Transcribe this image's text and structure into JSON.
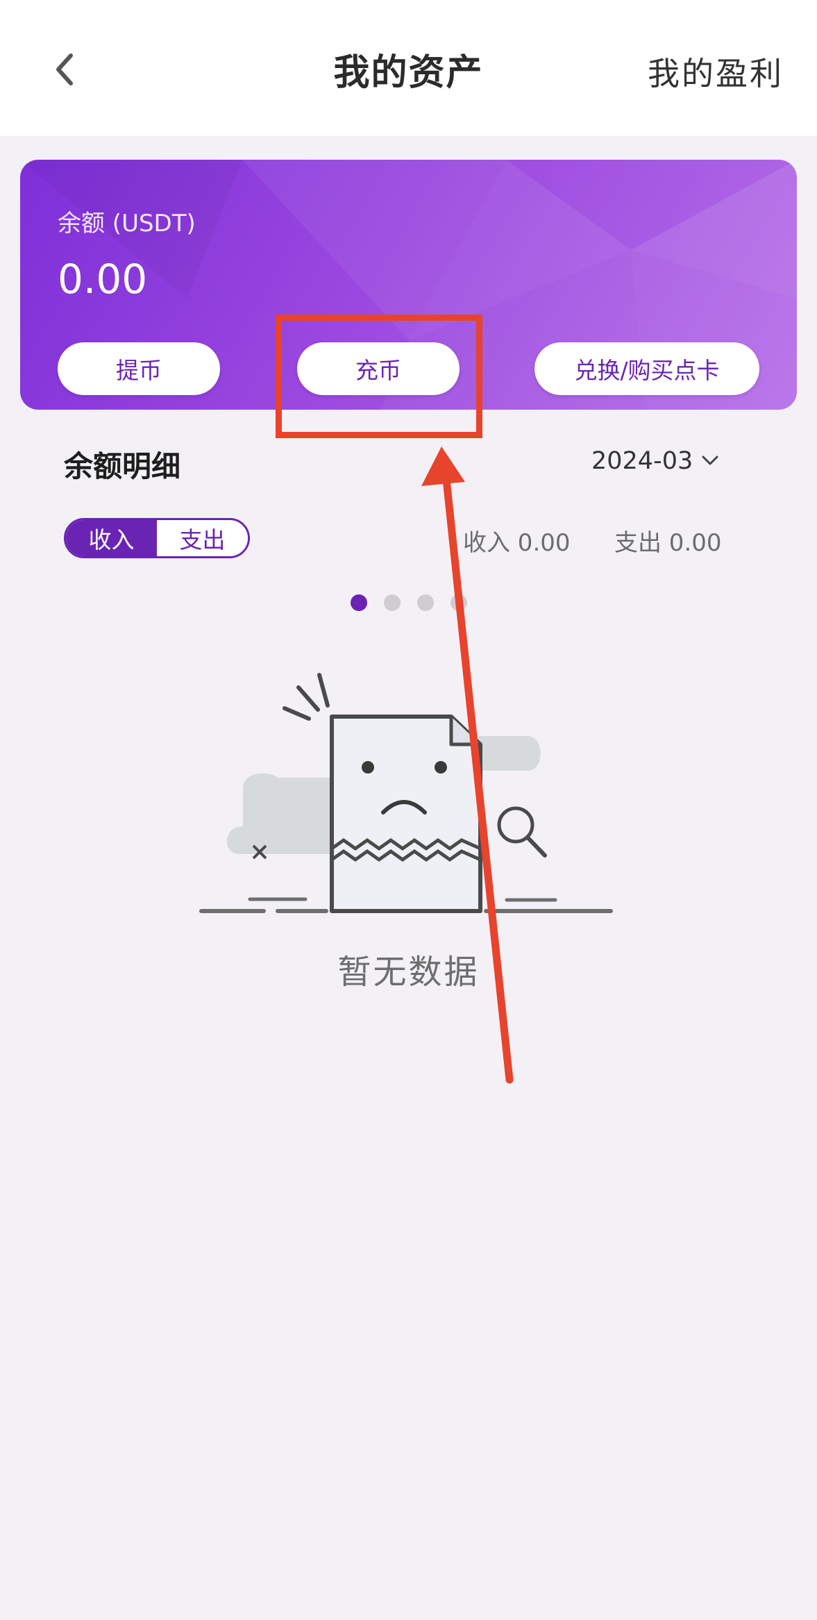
{
  "header": {
    "title": "我的资产",
    "right_link": "我的盈利"
  },
  "balance_card": {
    "label": "余额 (USDT)",
    "value": "0.00",
    "buttons": {
      "withdraw": "提币",
      "deposit": "充币",
      "exchange": "兑换/购买点卡"
    }
  },
  "details": {
    "title": "余额明细",
    "month": "2024-03",
    "toggle": {
      "income": "收入",
      "expense": "支出"
    },
    "income_summary": "收入 0.00",
    "expense_summary": "支出 0.00",
    "pagination_active_index": 1,
    "pagination_count": 4
  },
  "empty_state": {
    "text": "暂无数据"
  },
  "colors": {
    "accent": "#6a24b4",
    "annotation": "#e8432c"
  },
  "icons": {
    "back": "chevron-left-icon",
    "month_dropdown": "chevron-down-icon"
  }
}
